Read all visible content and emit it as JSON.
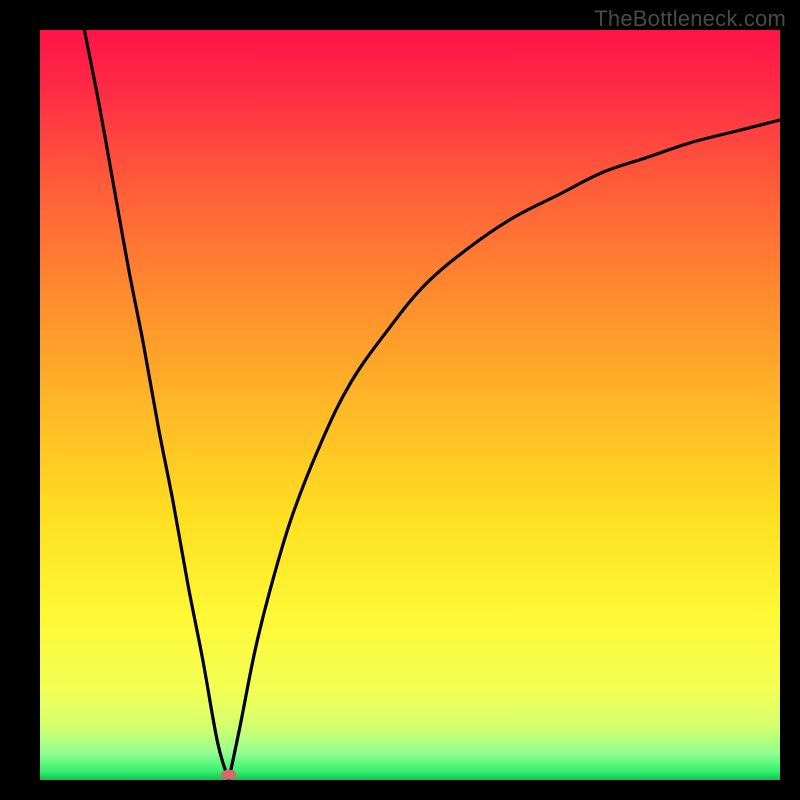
{
  "watermark": "TheBottleneck.com",
  "chart_data": {
    "type": "line",
    "title": "",
    "xlabel": "",
    "ylabel": "",
    "xlim": [
      0,
      100
    ],
    "ylim": [
      0,
      100
    ],
    "grid": false,
    "legend": false,
    "annotations": [],
    "series": [
      {
        "name": "left-branch",
        "x": [
          6,
          8,
          10,
          12,
          14,
          16,
          18,
          20,
          22,
          24,
          25.5
        ],
        "y": [
          100,
          90,
          79,
          68,
          58,
          47,
          37,
          26,
          16,
          5,
          0
        ]
      },
      {
        "name": "right-branch",
        "x": [
          25.5,
          27,
          29,
          31,
          34,
          38,
          42,
          47,
          52,
          58,
          64,
          70,
          76,
          82,
          88,
          94,
          100
        ],
        "y": [
          0,
          7,
          17,
          25,
          35,
          45,
          53,
          60,
          66,
          71,
          75,
          78,
          81,
          83,
          85,
          86.5,
          88
        ]
      }
    ],
    "marker": {
      "x": 25.5,
      "y": 0.7,
      "color": "#d6696f"
    },
    "background_gradient": {
      "stops": [
        {
          "pos": 0.0,
          "color": "#ff1449"
        },
        {
          "pos": 0.08,
          "color": "#ff2b45"
        },
        {
          "pos": 0.2,
          "color": "#ff5a3a"
        },
        {
          "pos": 0.35,
          "color": "#ff8a2f"
        },
        {
          "pos": 0.5,
          "color": "#ffb726"
        },
        {
          "pos": 0.65,
          "color": "#ffdf22"
        },
        {
          "pos": 0.78,
          "color": "#fff835"
        },
        {
          "pos": 0.88,
          "color": "#f3ff54"
        },
        {
          "pos": 0.93,
          "color": "#d3ff70"
        },
        {
          "pos": 0.965,
          "color": "#8fff91"
        },
        {
          "pos": 0.988,
          "color": "#37f070"
        },
        {
          "pos": 1.0,
          "color": "#10c44f"
        }
      ]
    }
  }
}
